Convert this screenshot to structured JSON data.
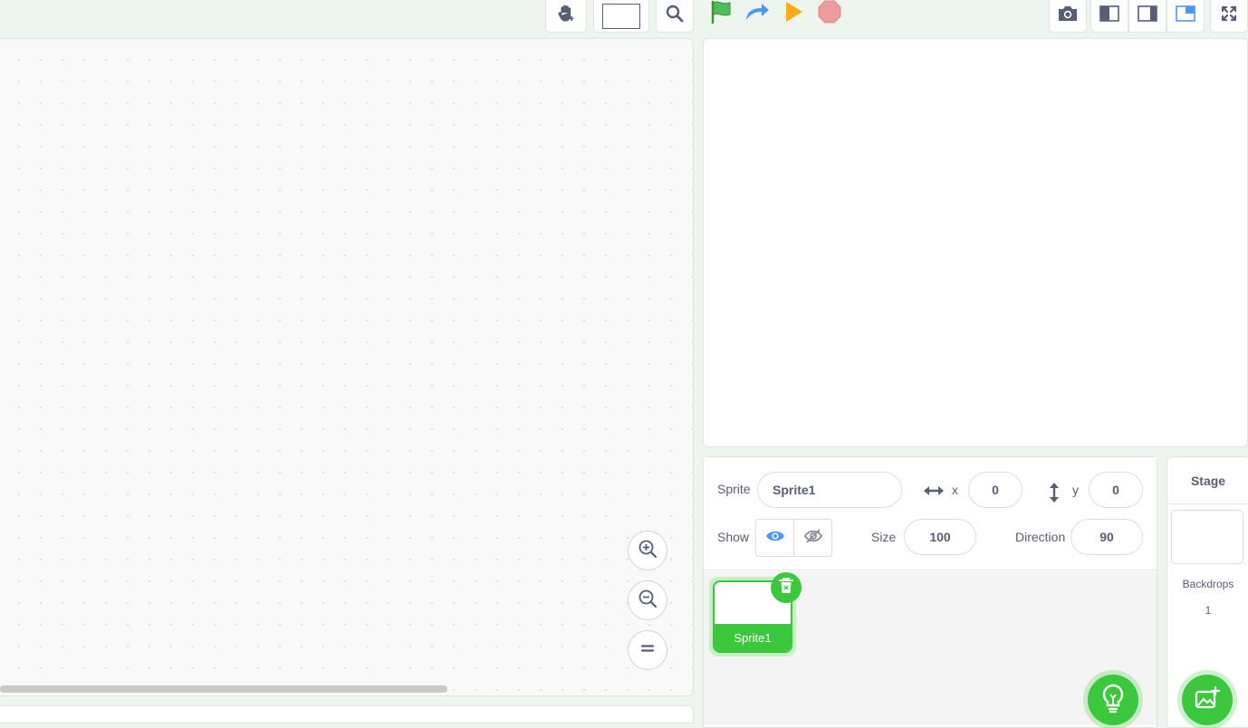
{
  "toolbar": {
    "hand_tool_icon": "hand-icon",
    "search_icon": "search-icon",
    "run_controls": [
      "green-flag-icon",
      "step-arrow-icon",
      "play-icon",
      "stop-icon"
    ],
    "view_buttons": [
      "camera-icon",
      "small-stage-icon",
      "normal-stage-icon",
      "layout-icon",
      "fullscreen-icon"
    ]
  },
  "sprite_info": {
    "sprite_label": "Sprite",
    "sprite_name": "Sprite1",
    "x_label": "x",
    "x_value": "0",
    "y_label": "y",
    "y_value": "0",
    "show_label": "Show",
    "size_label": "Size",
    "size_value": "100",
    "direction_label": "Direction",
    "direction_value": "90"
  },
  "sprites": [
    {
      "name": "Sprite1",
      "selected": true
    }
  ],
  "stage_pane": {
    "title": "Stage",
    "backdrops_label": "Backdrops",
    "backdrops_count": "1"
  },
  "colors": {
    "accent_green": "#3cc83c",
    "blue": "#4c97ff",
    "flag_green": "#4cbf56",
    "play_orange": "#ffab19",
    "stop_red": "#ec9c9c"
  }
}
